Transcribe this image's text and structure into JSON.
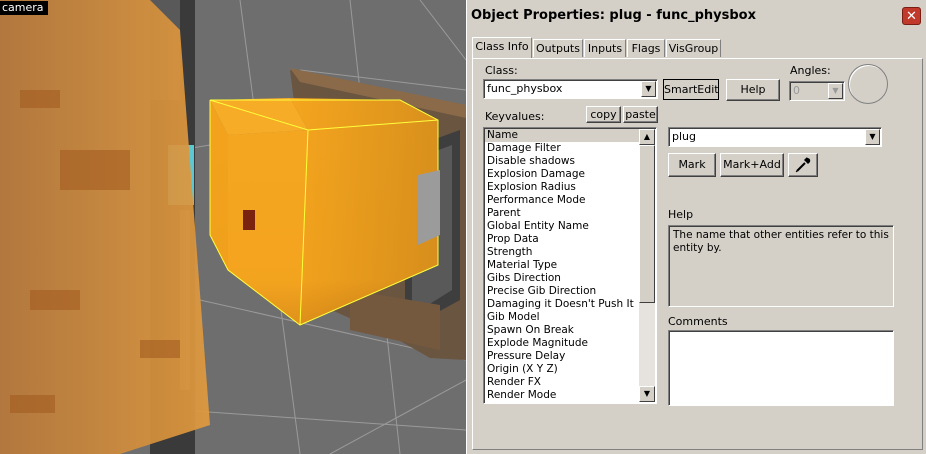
{
  "viewport": {
    "label": "camera",
    "colors": {
      "background": "#6e6e6e",
      "box_face_front": "#f3a31a",
      "box_face_top": "#f7ae2a",
      "box_outline": "#ffff3c"
    }
  },
  "dialog": {
    "title": "Object Properties: plug - func_physbox",
    "close_glyph": "✕",
    "tabs": [
      {
        "label": "Class Info",
        "active": true
      },
      {
        "label": "Outputs",
        "active": false
      },
      {
        "label": "Inputs",
        "active": false
      },
      {
        "label": "Flags",
        "active": false
      },
      {
        "label": "VisGroup",
        "active": false
      }
    ],
    "class_label": "Class:",
    "class_value": "func_physbox",
    "smartedit_label": "SmartEdit",
    "help_button": "Help",
    "angles_label": "Angles:",
    "angles_value": "0",
    "keyvalues_label": "Keyvalues:",
    "copy_button": "copy",
    "paste_button": "paste",
    "keyvalues": [
      "Name",
      "Damage Filter",
      "Disable shadows",
      "Explosion Damage",
      "Explosion Radius",
      "Performance Mode",
      "Parent",
      "Global Entity Name",
      "Prop Data",
      "Strength",
      "Material Type",
      "Gibs Direction",
      "Precise Gib Direction",
      "Damaging it Doesn't Push It",
      "Gib Model",
      "Spawn On Break",
      "Explode Magnitude",
      "Pressure Delay",
      "Origin (X Y Z)",
      "Render FX",
      "Render Mode"
    ],
    "selected_key": "Name",
    "value_current": "plug",
    "mark_button": "Mark",
    "mark_add_button": "Mark+Add",
    "eyedropper_icon": "eyedropper-icon",
    "help_label": "Help",
    "help_text": "The name that other entities refer to this entity by.",
    "comments_label": "Comments",
    "comments_value": ""
  }
}
